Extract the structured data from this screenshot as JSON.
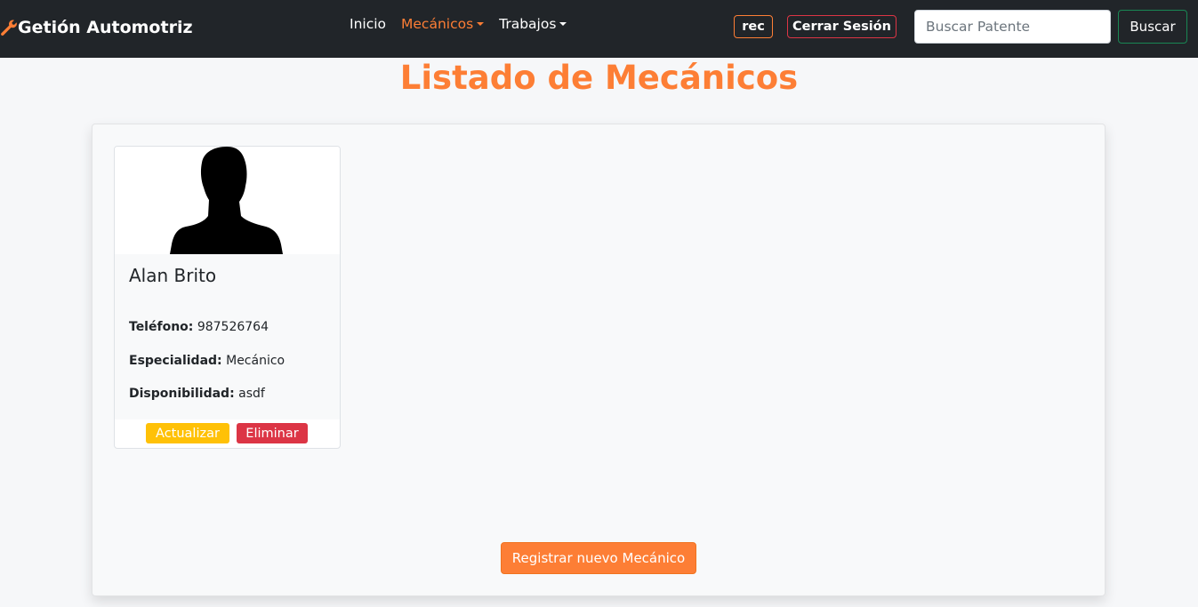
{
  "colors": {
    "navbar_bg": "#212529",
    "accent": "#fd7e35",
    "warning": "#ffc107",
    "danger": "#dc3545",
    "success_border": "#198754"
  },
  "navbar": {
    "brand": "Getión Automotriz",
    "brand_icon": "wrench-icon",
    "links": [
      {
        "label": "Inicio",
        "dropdown": false,
        "active": false
      },
      {
        "label": "Mecánicos",
        "dropdown": true,
        "active": true
      },
      {
        "label": "Trabajos",
        "dropdown": true,
        "active": false
      }
    ],
    "user": "rec",
    "logout_label": "Cerrar Sesión",
    "search_placeholder": "Buscar Patente",
    "search_value": "",
    "search_button": "Buscar"
  },
  "page": {
    "title": "Listado de Mecánicos",
    "register_button": "Registrar nuevo Mecánico"
  },
  "mechanics": [
    {
      "name": "Alan Brito",
      "image_icon": "person-silhouette-icon",
      "phone_label": "Teléfono:",
      "phone": "987526764",
      "specialty_label": "Especialidad:",
      "specialty": "Mecánico",
      "availability_label": "Disponibilidad:",
      "availability": "asdf",
      "update_label": "Actualizar",
      "delete_label": "Eliminar"
    }
  ]
}
